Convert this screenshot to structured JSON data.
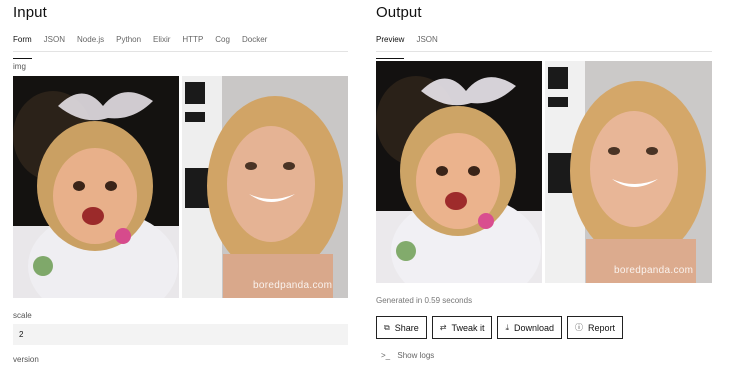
{
  "input": {
    "title": "Input",
    "tabs": [
      "Form",
      "JSON",
      "Node.js",
      "Python",
      "Elixir",
      "HTTP",
      "Cog",
      "Docker"
    ],
    "img_label": "img",
    "scale_label": "scale",
    "scale_value": "2",
    "version_label": "version",
    "watermark": "boredpanda.com"
  },
  "output": {
    "title": "Output",
    "tabs": [
      "Preview",
      "JSON"
    ],
    "watermark": "boredpanda.com",
    "generated_text": "Generated in 0.59 seconds",
    "buttons": {
      "share": "Share",
      "tweak": "Tweak it",
      "download": "Download",
      "report": "Report"
    },
    "show_logs": "Show logs"
  }
}
